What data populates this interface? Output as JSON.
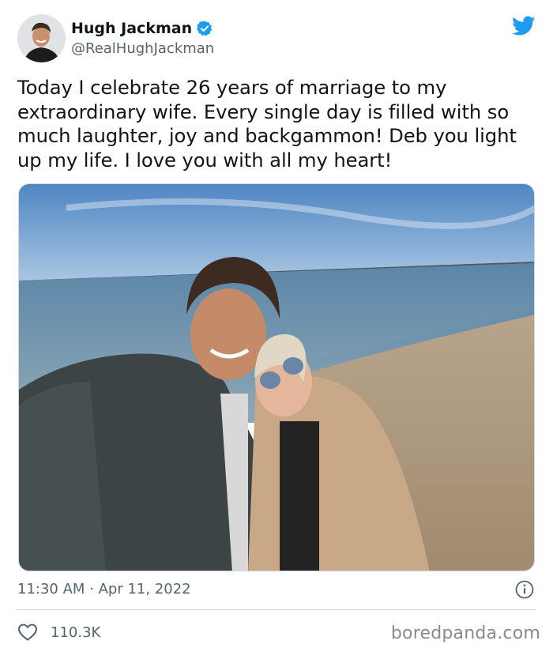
{
  "author": {
    "name": "Hugh Jackman",
    "handle": "@RealHughJackman",
    "verified": true
  },
  "tweet": {
    "text": "Today I celebrate 26 years of marriage to my extraordinary wife. Every single day is filled with so much laughter, joy and backgammon! Deb you light up my life. I love you with all my heart!",
    "timestamp": "11:30 AM · Apr 11, 2022",
    "likes": "110.3K"
  },
  "watermark": "boredpanda.com",
  "colors": {
    "twitter_blue": "#1d9bf0",
    "text_primary": "#0f1419",
    "text_secondary": "#536471",
    "divider": "#cfd9de"
  },
  "icons": {
    "brand": "twitter-bird-icon",
    "verified": "verified-badge-icon",
    "info": "info-icon",
    "like": "heart-icon"
  }
}
